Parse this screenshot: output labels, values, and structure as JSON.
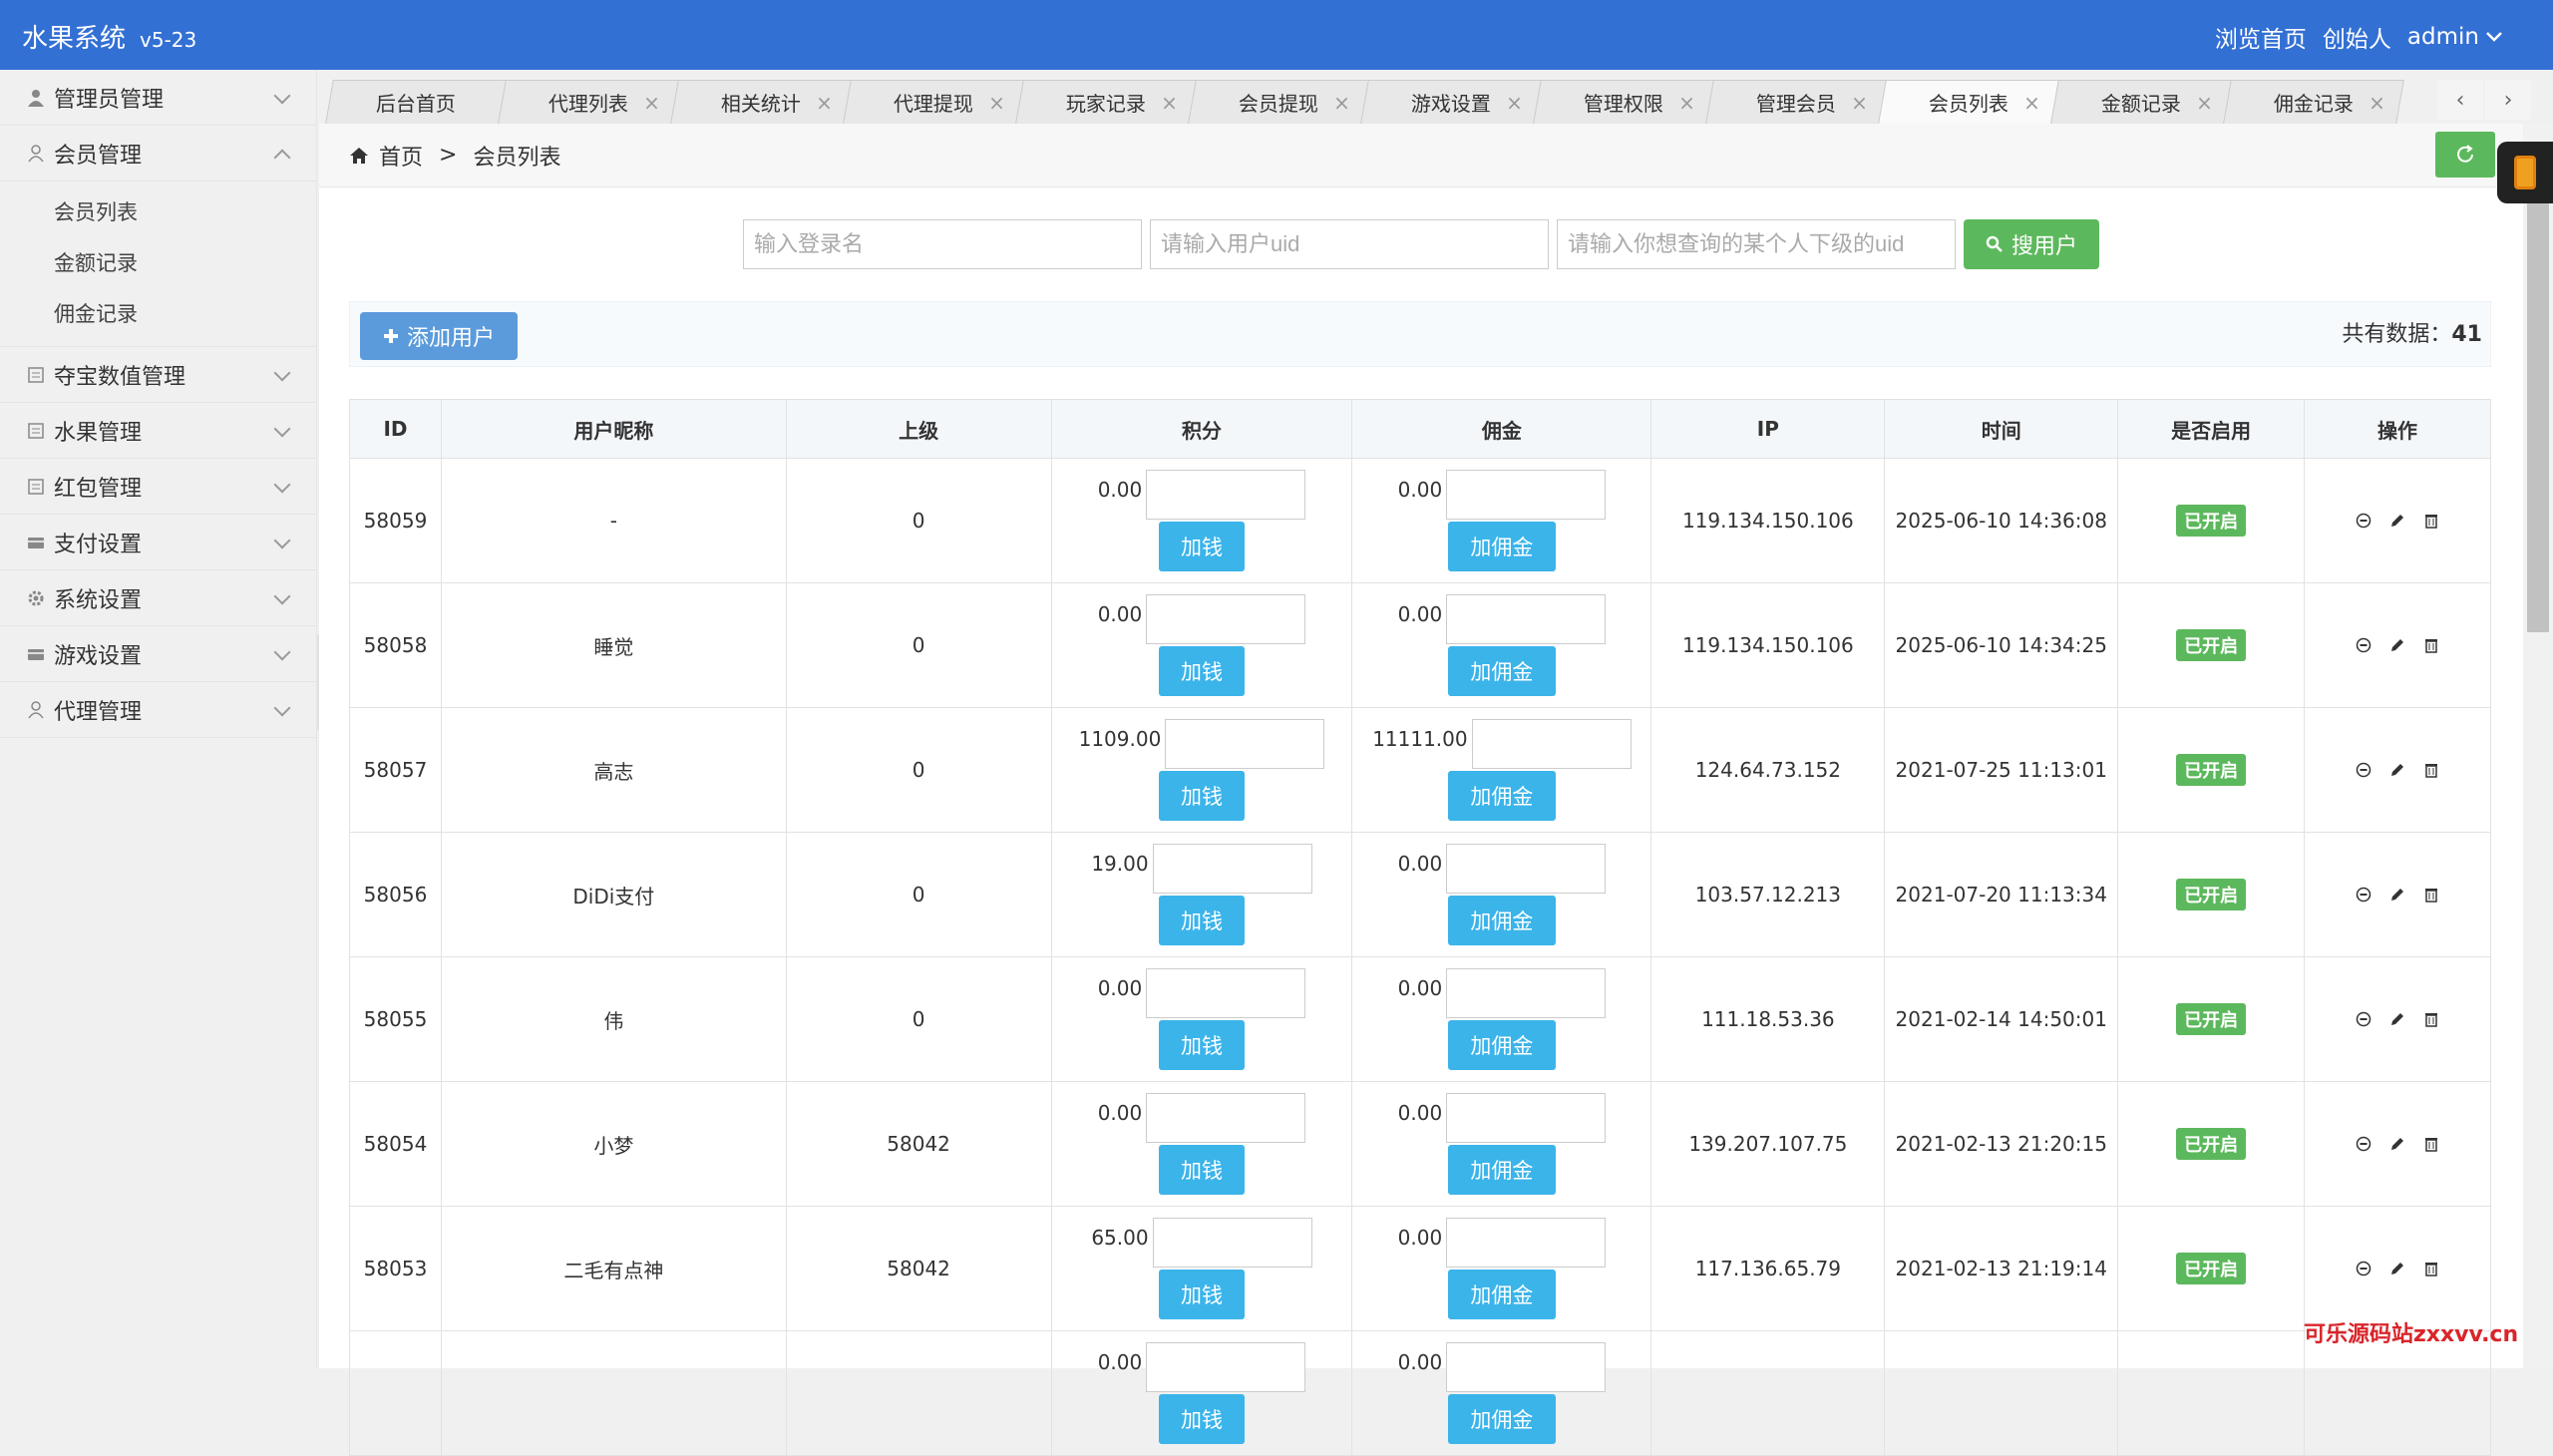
{
  "header": {
    "brand": "水果系统",
    "version": "v5-23",
    "browse_home": "浏览首页",
    "founder": "创始人",
    "user": "admin"
  },
  "sidebar": {
    "items": [
      {
        "label": "管理员管理",
        "icon": "user-icon"
      },
      {
        "label": "会员管理",
        "icon": "user-outline-icon"
      },
      {
        "label": "夺宝数值管理",
        "icon": "document-icon"
      },
      {
        "label": "水果管理",
        "icon": "document-icon"
      },
      {
        "label": "红包管理",
        "icon": "document-icon"
      },
      {
        "label": "支付设置",
        "icon": "card-icon"
      },
      {
        "label": "系统设置",
        "icon": "gear-icon"
      },
      {
        "label": "游戏设置",
        "icon": "card-icon"
      },
      {
        "label": "代理管理",
        "icon": "user-outline-icon"
      }
    ],
    "sub_items": [
      "会员列表",
      "金额记录",
      "佣金记录"
    ]
  },
  "tabs": [
    "后台首页",
    "代理列表",
    "相关统计",
    "代理提现",
    "玩家记录",
    "会员提现",
    "游戏设置",
    "管理权限",
    "管理会员",
    "会员列表",
    "金额记录",
    "佣金记录"
  ],
  "breadcrumb": {
    "home": "首页",
    "sep": ">",
    "current": "会员列表"
  },
  "search": {
    "login_placeholder": "输入登录名",
    "uid_placeholder": "请输入用户uid",
    "sub_placeholder": "请输入你想查询的某个人下级的uid",
    "button": "搜用户"
  },
  "toolbar": {
    "add_user": "添加用户",
    "total_label": "共有数据：",
    "total_value": "41"
  },
  "table": {
    "headers": [
      "ID",
      "用户昵称",
      "上级",
      "积分",
      "佣金",
      "IP",
      "时间",
      "是否启用",
      "操作"
    ],
    "add_money_label": "加钱",
    "add_commission_label": "加佣金",
    "rows": [
      {
        "id": "58059",
        "nickname": "-",
        "parent": "0",
        "points": "0.00",
        "commission": "0.00",
        "ip": "119.134.150.106",
        "time": "2025-06-10 14:36:08",
        "status": "已开启"
      },
      {
        "id": "58058",
        "nickname": "睡觉",
        "parent": "0",
        "points": "0.00",
        "commission": "0.00",
        "ip": "119.134.150.106",
        "time": "2025-06-10 14:34:25",
        "status": "已开启"
      },
      {
        "id": "58057",
        "nickname": "高志",
        "parent": "0",
        "points": "1109.00",
        "commission": "11111.00",
        "ip": "124.64.73.152",
        "time": "2021-07-25 11:13:01",
        "status": "已开启"
      },
      {
        "id": "58056",
        "nickname": "DiDi支付",
        "parent": "0",
        "points": "19.00",
        "commission": "0.00",
        "ip": "103.57.12.213",
        "time": "2021-07-20 11:13:34",
        "status": "已开启"
      },
      {
        "id": "58055",
        "nickname": "伟",
        "parent": "0",
        "points": "0.00",
        "commission": "0.00",
        "ip": "111.18.53.36",
        "time": "2021-02-14 14:50:01",
        "status": "已开启"
      },
      {
        "id": "58054",
        "nickname": "小梦",
        "parent": "58042",
        "points": "0.00",
        "commission": "0.00",
        "ip": "139.207.107.75",
        "time": "2021-02-13 21:20:15",
        "status": "已开启"
      },
      {
        "id": "58053",
        "nickname": "二毛有点神",
        "parent": "58042",
        "points": "65.00",
        "commission": "0.00",
        "ip": "117.136.65.79",
        "time": "2021-02-13 21:19:14",
        "status": "已开启"
      },
      {
        "id": "",
        "nickname": "",
        "parent": "",
        "points": "0.00",
        "commission": "0.00",
        "ip": "",
        "time": "",
        "status": ""
      }
    ]
  },
  "watermark": "可乐源码站zxxvv.cn",
  "colors": {
    "header": "#3370d4",
    "success": "#5cb85c",
    "info": "#3bb4ea",
    "primary": "#5b9bdc"
  }
}
